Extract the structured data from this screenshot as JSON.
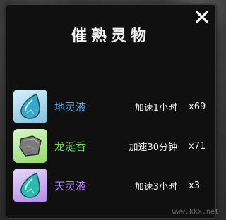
{
  "dialog": {
    "title": "催熟灵物"
  },
  "colors": {
    "name_blue": "#5aa8e8",
    "name_green": "#6ed850",
    "name_purple": "#b67cff"
  },
  "items": [
    {
      "name": "地灵液",
      "effect": "加速1小时",
      "count": "x69",
      "icon": "blue-crystal-drop-icon"
    },
    {
      "name": "龙涎香",
      "effect": "加速30分钟",
      "count": "x71",
      "icon": "gray-stone-icon"
    },
    {
      "name": "天灵液",
      "effect": "加速3小时",
      "count": "x3",
      "icon": "teal-crystal-drop-icon"
    }
  ],
  "watermark": "www.kkx.net"
}
